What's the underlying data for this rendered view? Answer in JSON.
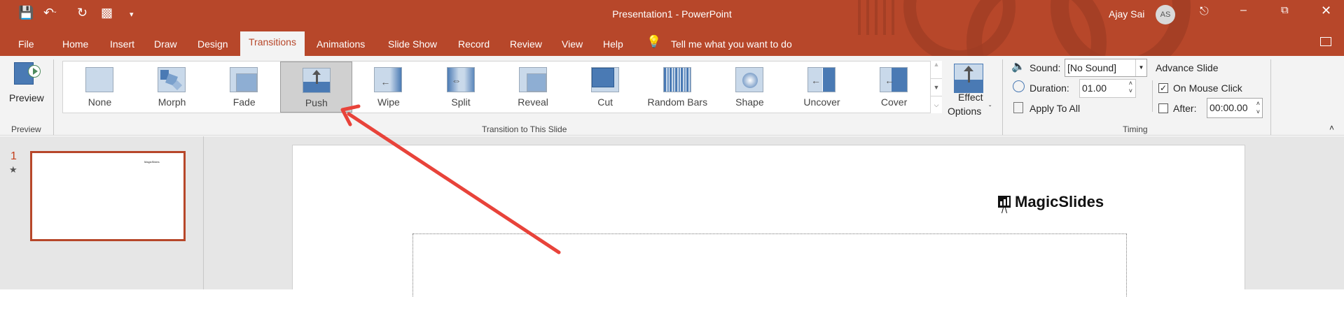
{
  "window": {
    "title": "Presentation1  -  PowerPoint",
    "user": "Ajay Sai",
    "avatar_initials": "AS"
  },
  "tabs": [
    "File",
    "Home",
    "Insert",
    "Draw",
    "Design",
    "Transitions",
    "Animations",
    "Slide Show",
    "Record",
    "Review",
    "View",
    "Help"
  ],
  "active_tab": "Transitions",
  "tell_me": "Tell me what you want to do",
  "preview": {
    "label": "Preview",
    "group": "Preview"
  },
  "transitions": {
    "group": "Transition to This Slide",
    "selected": "Push",
    "items": [
      "None",
      "Morph",
      "Fade",
      "Push",
      "Wipe",
      "Split",
      "Reveal",
      "Cut",
      "Random Bars",
      "Shape",
      "Uncover",
      "Cover"
    ]
  },
  "effect_options": {
    "line1": "Effect",
    "line2": "Options"
  },
  "timing": {
    "group": "Timing",
    "sound_label": "Sound:",
    "sound_value": "[No Sound]",
    "duration_label": "Duration:",
    "duration_value": "01.00",
    "apply_all": "Apply To All",
    "advance_title": "Advance Slide",
    "on_mouse_click": "On Mouse Click",
    "on_mouse_click_checked": true,
    "after_label": "After:",
    "after_checked": false,
    "after_value": "00:00.00"
  },
  "slides": {
    "number": "1"
  },
  "slide": {
    "logo_text": "MagicSlides"
  },
  "colors": {
    "accent": "#b7472a",
    "arrow": "#e8433a"
  }
}
